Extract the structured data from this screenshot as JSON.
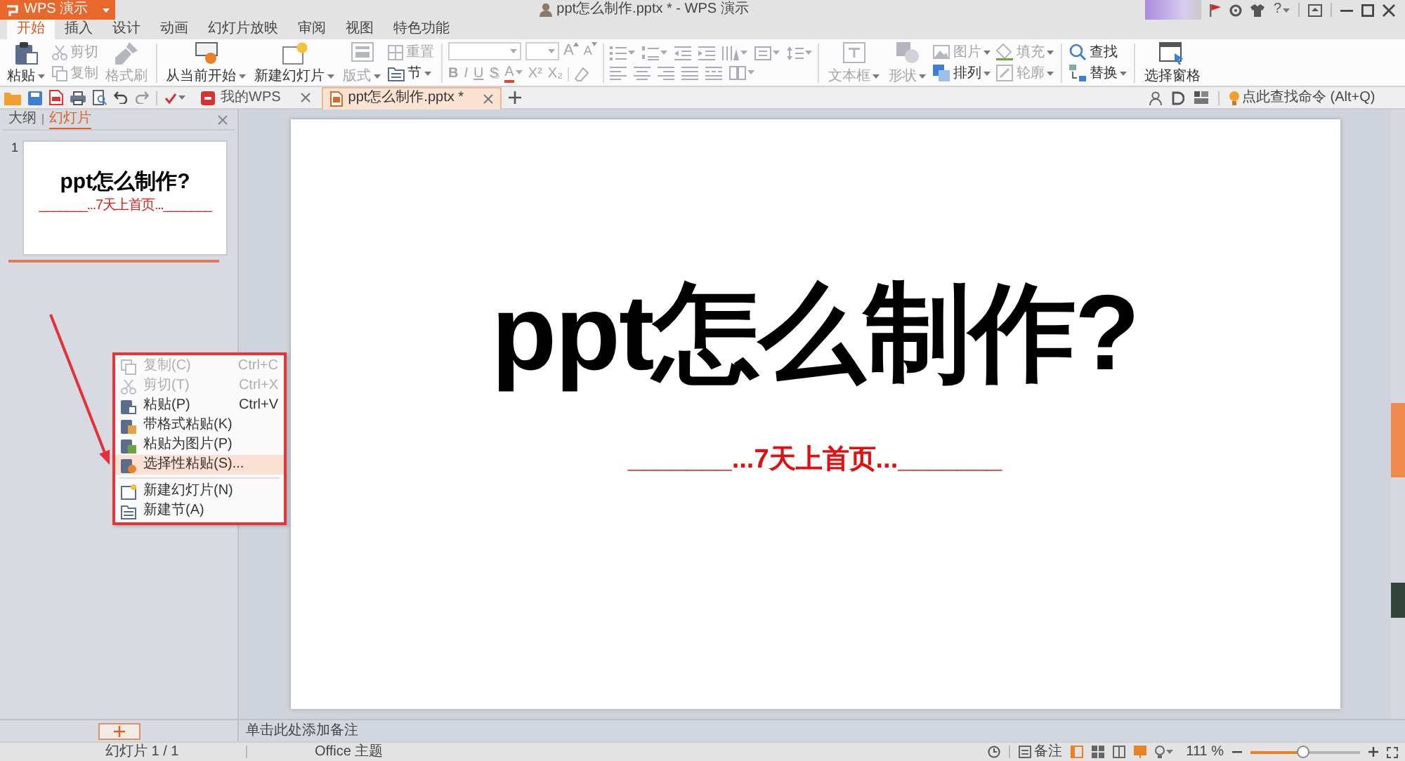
{
  "app_button": {
    "label": "WPS 演示"
  },
  "window": {
    "title": "ppt怎么制作.pptx * - WPS 演示",
    "help": "?"
  },
  "ribbon_tabs": [
    {
      "label": "开始",
      "selected": true
    },
    {
      "label": "插入",
      "selected": false
    },
    {
      "label": "设计",
      "selected": false
    },
    {
      "label": "动画",
      "selected": false
    },
    {
      "label": "幻灯片放映",
      "selected": false
    },
    {
      "label": "审阅",
      "selected": false
    },
    {
      "label": "视图",
      "selected": false
    },
    {
      "label": "特色功能",
      "selected": false
    }
  ],
  "ribbon": {
    "clipboard": [
      {
        "label": "粘贴",
        "disabled": false
      },
      {
        "label": "剪切",
        "disabled": true
      },
      {
        "label": "复制",
        "disabled": true
      },
      {
        "label": "格式刷",
        "disabled": true
      }
    ],
    "slides": [
      {
        "label": "从当前开始",
        "disabled": false
      },
      {
        "label": "新建幻灯片",
        "disabled": false
      },
      {
        "label": "版式",
        "disabled": true
      },
      {
        "label": "重置",
        "disabled": true
      },
      {
        "label": "节",
        "disabled": false
      }
    ],
    "font": {
      "disabled": true,
      "size_buttons": [
        "A",
        "A"
      ],
      "style_buttons": [
        "B",
        "I",
        "U",
        "S",
        "A",
        "X²",
        "X₂"
      ]
    },
    "drawing": [
      {
        "label": "文本框",
        "disabled": true
      },
      {
        "label": "形状",
        "disabled": true
      },
      {
        "label": "图片",
        "disabled": true
      },
      {
        "label": "排列",
        "disabled": false
      },
      {
        "label": "填充",
        "disabled": true
      },
      {
        "label": "轮廓",
        "disabled": true
      }
    ],
    "editing": [
      {
        "label": "查找",
        "disabled": false
      },
      {
        "label": "替换",
        "disabled": false
      }
    ],
    "selection_pane": {
      "label": "选择窗格",
      "disabled": false
    }
  },
  "doc_tabs": [
    {
      "label": "我的WPS",
      "selected": false
    },
    {
      "label": "ppt怎么制作.pptx *",
      "selected": true
    }
  ],
  "command_search": {
    "placeholder": "点此查找命令 (Alt+Q)"
  },
  "side_panel": {
    "tabs": [
      {
        "label": "大纲",
        "selected": false
      },
      {
        "label": "幻灯片",
        "selected": true
      }
    ],
    "slides": [
      {
        "number": "1",
        "title": "ppt怎么制作?",
        "subtitle": "_______...7天上首页..._______"
      }
    ]
  },
  "slide": {
    "title": "ppt怎么制作?",
    "subtitle": "_______...7天上首页..._______"
  },
  "context_menu": [
    {
      "kind": "item",
      "label": "复制(C)",
      "shortcut": "Ctrl+C",
      "disabled": true,
      "selected": false
    },
    {
      "kind": "item",
      "label": "剪切(T)",
      "shortcut": "Ctrl+X",
      "disabled": true,
      "selected": false
    },
    {
      "kind": "item",
      "label": "粘贴(P)",
      "shortcut": "Ctrl+V",
      "disabled": false,
      "selected": false
    },
    {
      "kind": "item",
      "label": "带格式粘贴(K)",
      "disabled": false,
      "selected": false
    },
    {
      "kind": "item",
      "label": "粘贴为图片(P)",
      "disabled": false,
      "selected": false
    },
    {
      "kind": "item",
      "label": "选择性粘贴(S)...",
      "disabled": false,
      "selected": true
    },
    {
      "kind": "separator"
    },
    {
      "kind": "item",
      "label": "新建幻灯片(N)",
      "disabled": false,
      "selected": false
    },
    {
      "kind": "item",
      "label": "新建节(A)",
      "disabled": false,
      "selected": false
    }
  ],
  "notes": {
    "placeholder": "单击此处添加备注"
  },
  "status_bar": {
    "slide_info": "幻灯片 1 / 1",
    "theme": "Office 主题",
    "notes_label": "备注",
    "views": [
      {
        "selected": true
      },
      {
        "selected": false
      },
      {
        "selected": false
      }
    ],
    "zoom": "111 %",
    "zoom_slider": {
      "level": 0.48
    }
  }
}
